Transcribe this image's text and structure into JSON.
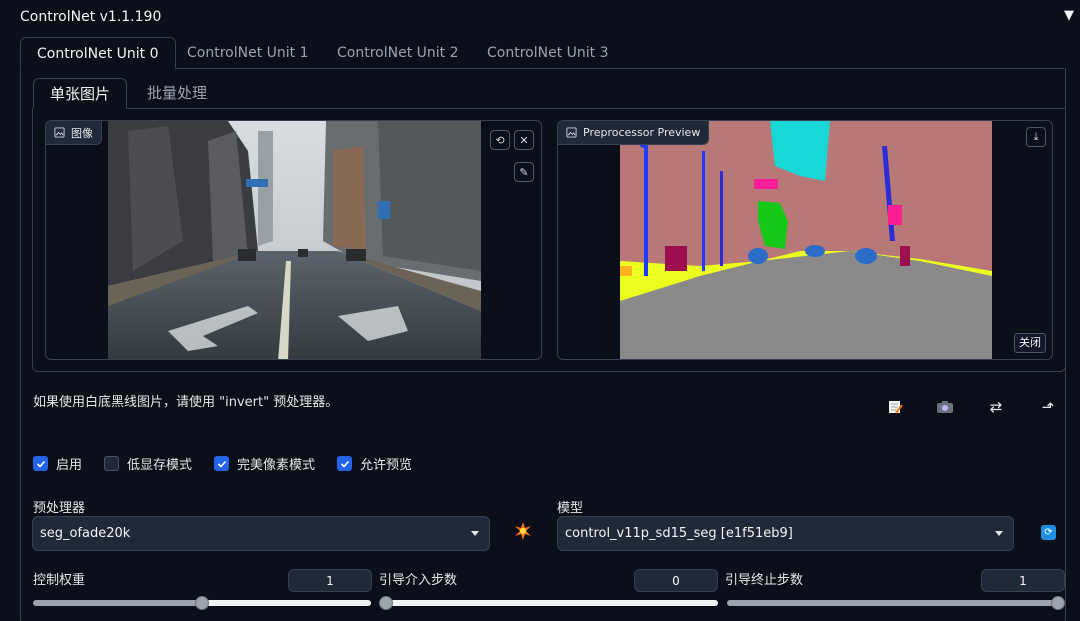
{
  "header": {
    "title": "ControlNet v1.1.190",
    "collapse_icon": "triangle-down-icon"
  },
  "unit_tabs": [
    {
      "label": "ControlNet Unit 0",
      "active": true
    },
    {
      "label": "ControlNet Unit 1",
      "active": false
    },
    {
      "label": "ControlNet Unit 2",
      "active": false
    },
    {
      "label": "ControlNet Unit 3",
      "active": false
    }
  ],
  "sub_tabs": [
    {
      "label": "单张图片",
      "active": true
    },
    {
      "label": "批量处理",
      "active": false
    }
  ],
  "image_panel": {
    "label": "图像",
    "icon": "image-icon"
  },
  "preview_panel": {
    "label": "Preprocessor Preview",
    "icon": "image-icon",
    "close_label": "关闭"
  },
  "hint": "如果使用白底黑线图片，请使用 \"invert\" 预处理器。",
  "actions": [
    "edit-icon",
    "camera-icon",
    "swap-icon",
    "send-icon"
  ],
  "checkboxes": [
    {
      "label": "启用",
      "checked": true
    },
    {
      "label": "低显存模式",
      "checked": false
    },
    {
      "label": "完美像素模式",
      "checked": true
    },
    {
      "label": "允许预览",
      "checked": true
    }
  ],
  "preprocessor": {
    "label": "预处理器",
    "value": "seg_ofade20k"
  },
  "model": {
    "label": "模型",
    "value": "control_v11p_sd15_seg [e1f51eb9]"
  },
  "sliders": {
    "weight": {
      "label": "控制权重",
      "value": "1",
      "fraction": 0.5
    },
    "start": {
      "label": "引导介入步数",
      "value": "0",
      "fraction": 0.0
    },
    "end": {
      "label": "引导终止步数",
      "value": "1",
      "fraction": 1.0
    }
  },
  "colors": {
    "accent": "#2563eb",
    "refresh": "#1d8fe0",
    "background": "#0b0f19"
  }
}
